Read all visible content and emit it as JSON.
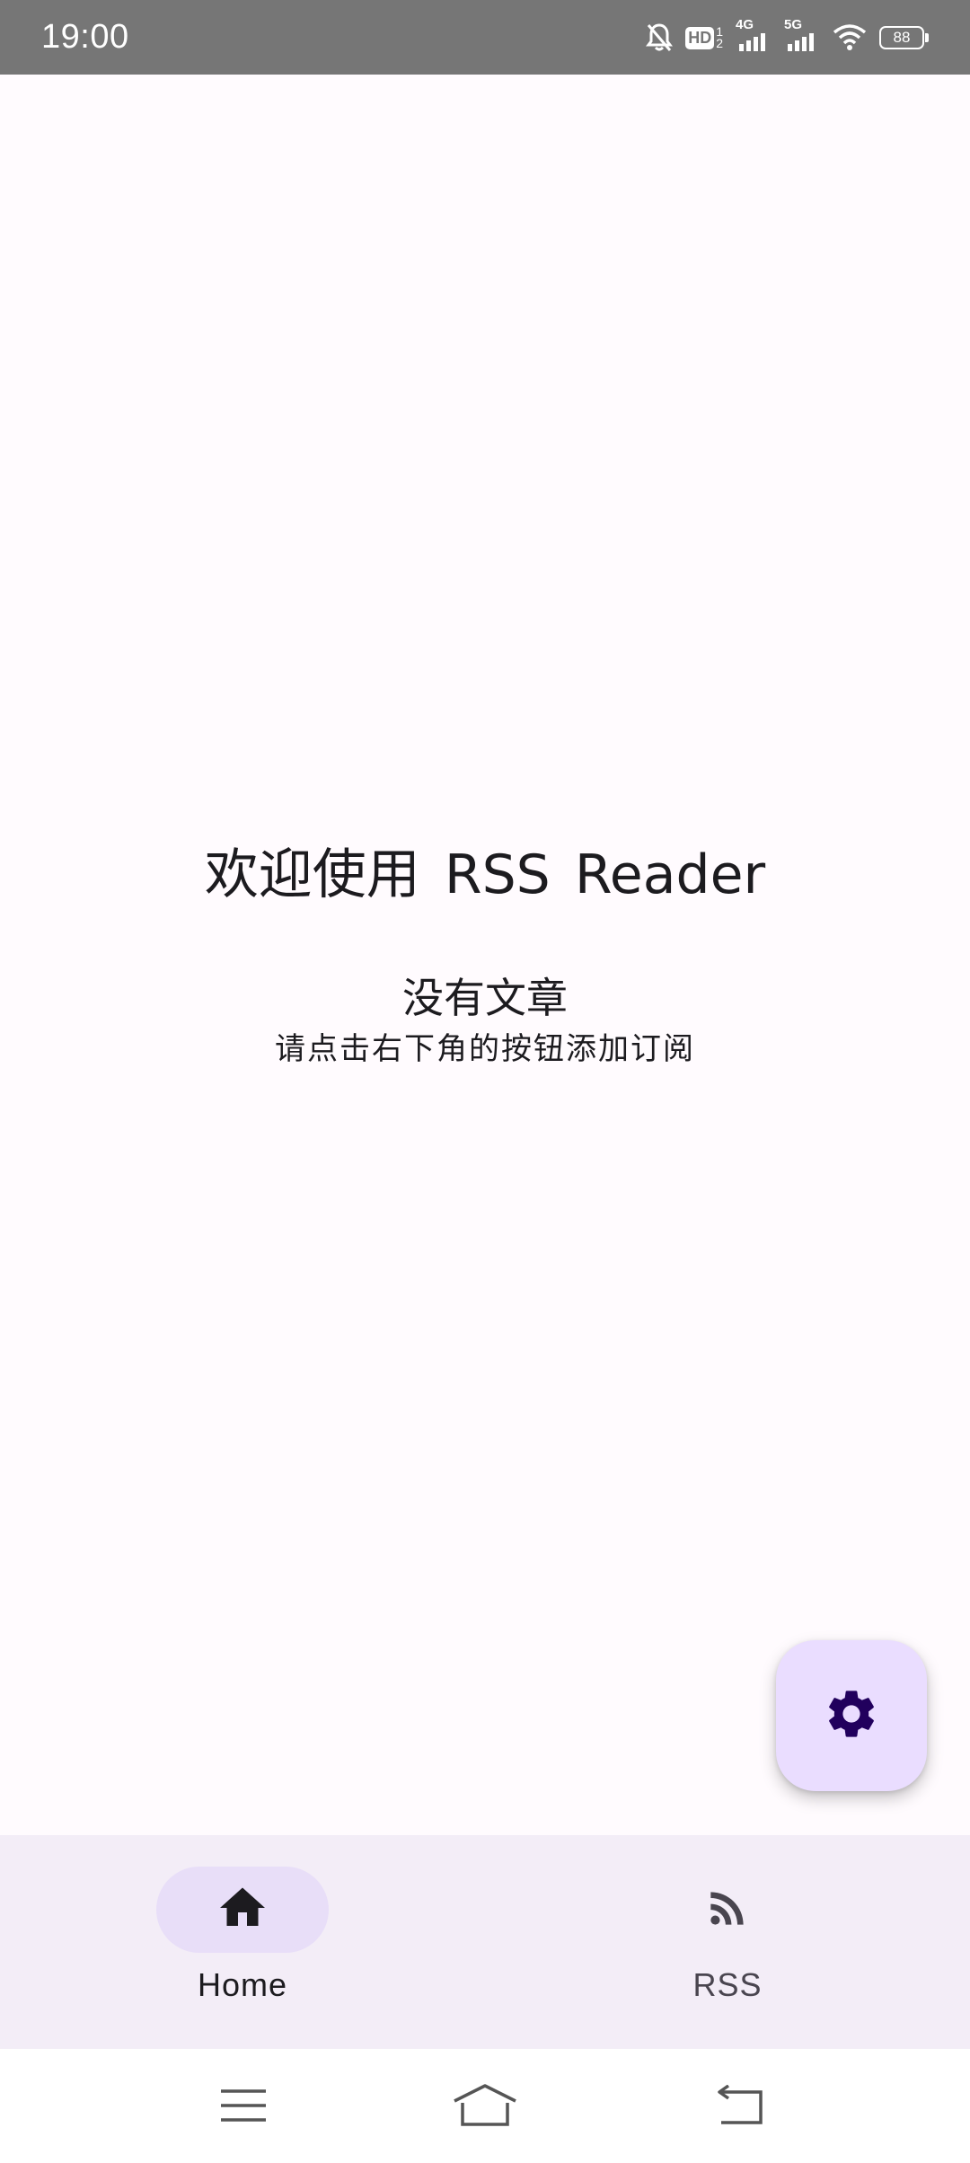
{
  "status_bar": {
    "time": "19:00",
    "battery": "88",
    "network_1": "4G",
    "network_2": "5G",
    "hd_label": "HD"
  },
  "main": {
    "welcome_title": "欢迎使用 RSS Reader",
    "empty_title": "没有文章",
    "empty_subtitle": "请点击右下角的按钮添加订阅"
  },
  "fab": {
    "icon": "gear-icon"
  },
  "bottom_nav": {
    "items": [
      {
        "label": "Home",
        "icon": "home-icon",
        "selected": true
      },
      {
        "label": "RSS",
        "icon": "rss-icon",
        "selected": false
      }
    ]
  },
  "system_nav": {
    "icons": [
      "menu-icon",
      "home-outline-icon",
      "back-icon"
    ]
  },
  "colors": {
    "background": "#fffbfe",
    "status_bar": "#767676",
    "fab": "#eaddff",
    "fab_icon": "#21005d",
    "nav_bar": "#f3edf7",
    "nav_indicator": "#e8def8"
  }
}
